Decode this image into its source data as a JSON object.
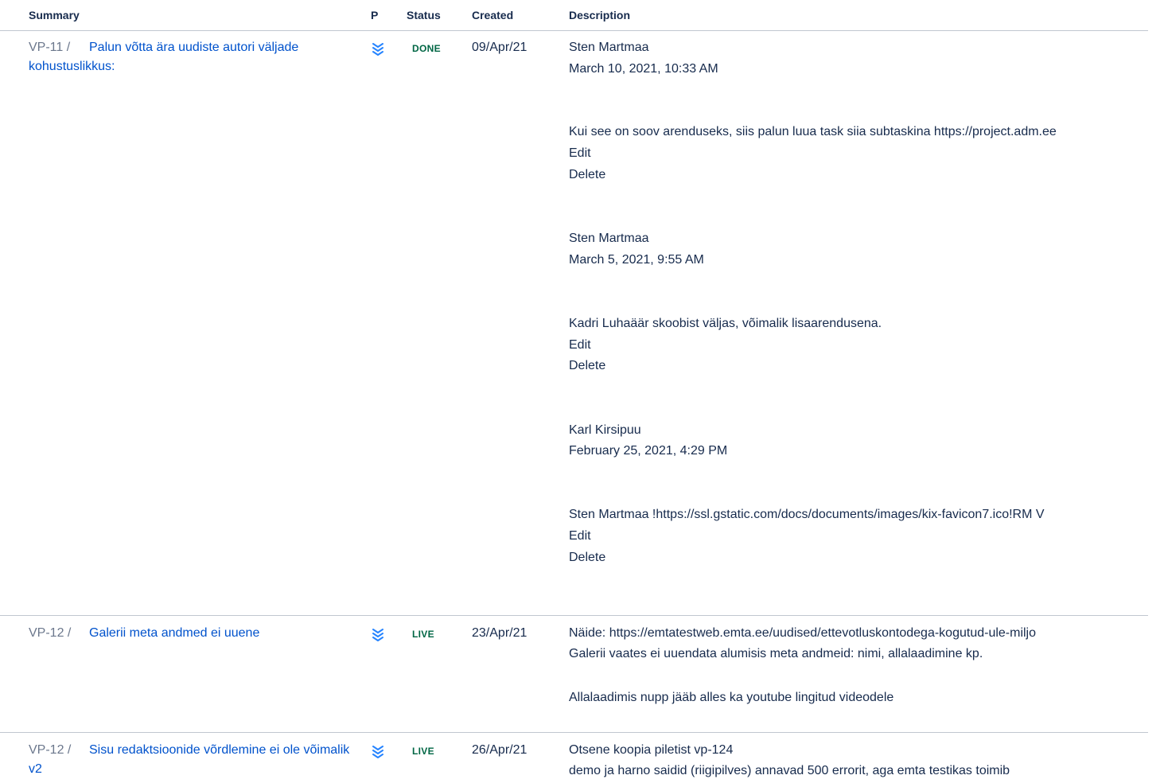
{
  "header": {
    "summary": "Summary",
    "priority": "P",
    "status": "Status",
    "created": "Created",
    "description": "Description"
  },
  "rows": [
    {
      "key": "VP-11 /",
      "summary": "Palun võtta ära uudiste autori väljade kohustuslikkus:",
      "priority_icon": "lowest-priority-icon",
      "status": "DONE",
      "created": "09/Apr/21",
      "comments": [
        {
          "author": "Sten Martmaa",
          "date": "March 10, 2021, 10:33 AM",
          "body": "Kui see on soov arenduseks, siis palun luua task siia subtaskina https://project.adm.ee",
          "edit": "Edit",
          "delete": "Delete"
        },
        {
          "author": "Sten Martmaa",
          "date": "March 5, 2021, 9:55 AM",
          "body": "Kadri Luhaäär skoobist väljas, võimalik lisaarendusena.",
          "edit": "Edit",
          "delete": "Delete"
        },
        {
          "author": "Karl Kirsipuu",
          "date": "February 25, 2021, 4:29 PM",
          "body": "Sten Martmaa !https://ssl.gstatic.com/docs/documents/images/kix-favicon7.ico!RM V",
          "edit": "Edit",
          "delete": "Delete"
        }
      ]
    },
    {
      "key": "VP-12 /",
      "summary": "Galerii meta andmed ei uuene",
      "priority_icon": "lowest-priority-icon",
      "status": "LIVE",
      "created": "23/Apr/21",
      "desc_lines": [
        "Näide: https://emtatestweb.emta.ee/uudised/ettevotluskontodega-kogutud-ule-miljo",
        "Galerii vaates ei uuendata alumisis meta andmeid: nimi, allalaadimine kp.",
        "Allalaadimis nupp jääb alles ka youtube lingitud videodele"
      ]
    },
    {
      "key": "VP-12 /",
      "summary": "Sisu redaktsioonide võrdlemine ei ole võimalik v2",
      "priority_icon": "lowest-priority-icon",
      "status": "LIVE",
      "created": "26/Apr/21",
      "desc_lines": [
        "Otsene koopia piletist vp-124",
        "demo ja harno saidid (riigipilves) annavad 500 errorit, aga emta testikas toimib"
      ]
    }
  ],
  "colors": {
    "link": "#0052cc",
    "status_green": "#006644",
    "priority_blue": "#2684ff",
    "divider": "#c1c7d0"
  }
}
